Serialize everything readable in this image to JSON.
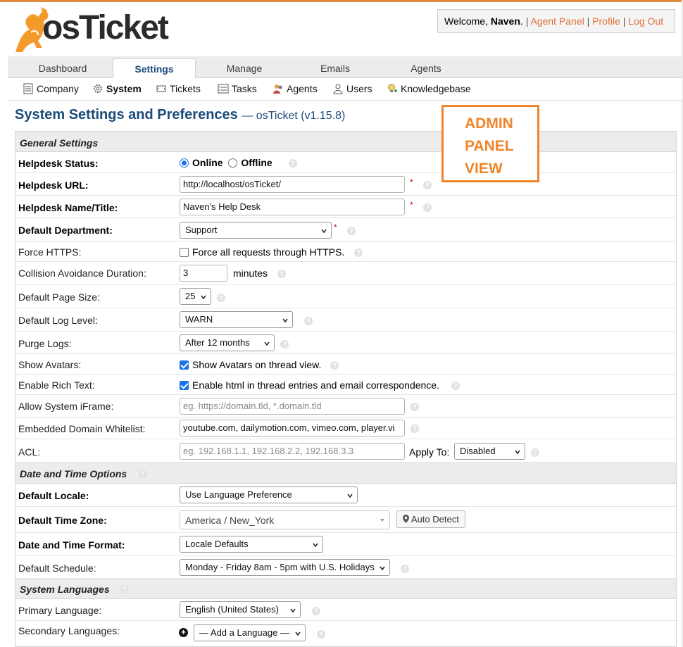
{
  "header": {
    "logo_text": "osTicket",
    "welcome_prefix": "Welcome, ",
    "user_name": "Naven",
    "welcome_suffix": ".",
    "sep": "|",
    "agent_panel": "Agent Panel",
    "profile": "Profile",
    "logout": "Log Out",
    "link_color": "#e0713a"
  },
  "nav": {
    "tabs": [
      "Dashboard",
      "Settings",
      "Manage",
      "Emails",
      "Agents"
    ],
    "active": "Settings"
  },
  "subnav": {
    "items": [
      "Company",
      "System",
      "Tickets",
      "Tasks",
      "Agents",
      "Users",
      "Knowledgebase"
    ],
    "active": "System"
  },
  "page": {
    "title": "System Settings and Preferences",
    "subtitle": "— osTicket (v1.15.8)"
  },
  "overlay": {
    "lines": [
      "ADMIN",
      "PANEL",
      "VIEW"
    ],
    "color": "#f08428"
  },
  "general": {
    "header": "General Settings",
    "helpdesk_status": {
      "label": "Helpdesk Status:",
      "online": "Online",
      "offline": "Offline"
    },
    "helpdesk_url": {
      "label": "Helpdesk URL:",
      "value": "http://localhost/osTicket/"
    },
    "helpdesk_name": {
      "label": "Helpdesk Name/Title:",
      "value": "Naven's Help Desk"
    },
    "default_dept": {
      "label": "Default Department:",
      "value": "Support"
    },
    "force_https": {
      "label": "Force HTTPS:",
      "text": "Force all requests through HTTPS."
    },
    "collision": {
      "label": "Collision Avoidance Duration:",
      "value": "3",
      "unit": "minutes"
    },
    "page_size": {
      "label": "Default Page Size:",
      "value": "25"
    },
    "log_level": {
      "label": "Default Log Level:",
      "value": "WARN"
    },
    "purge_logs": {
      "label": "Purge Logs:",
      "value": "After 12 months"
    },
    "show_avatars": {
      "label": "Show Avatars:",
      "text": "Show Avatars on thread view."
    },
    "rich_text": {
      "label": "Enable Rich Text:",
      "text": "Enable html in thread entries and email correspondence."
    },
    "iframe": {
      "label": "Allow System iFrame:",
      "placeholder": "eg. https://domain.tld, *.domain.tld"
    },
    "whitelist": {
      "label": "Embedded Domain Whitelist:",
      "value": "youtube.com, dailymotion.com, vimeo.com, player.vi"
    },
    "acl": {
      "label": "ACL:",
      "placeholder": "eg. 192.168.1.1, 192.168.2.2, 192.168.3.3",
      "apply_label": "Apply To:",
      "apply_value": "Disabled"
    }
  },
  "datetime": {
    "header": "Date and Time Options",
    "locale": {
      "label": "Default Locale:",
      "value": "Use Language Preference"
    },
    "timezone": {
      "label": "Default Time Zone:",
      "value": "America / New_York",
      "detect": "Auto Detect"
    },
    "format": {
      "label": "Date and Time Format:",
      "value": "Locale Defaults"
    },
    "schedule": {
      "label": "Default Schedule:",
      "value": "Monday - Friday 8am - 5pm with U.S. Holidays"
    }
  },
  "languages": {
    "header": "System Languages",
    "primary": {
      "label": "Primary Language:",
      "value": "English (United States)"
    },
    "secondary": {
      "label": "Secondary Languages:",
      "value": "— Add a Language —"
    }
  },
  "help_glyph": "?",
  "required_glyph": "*"
}
